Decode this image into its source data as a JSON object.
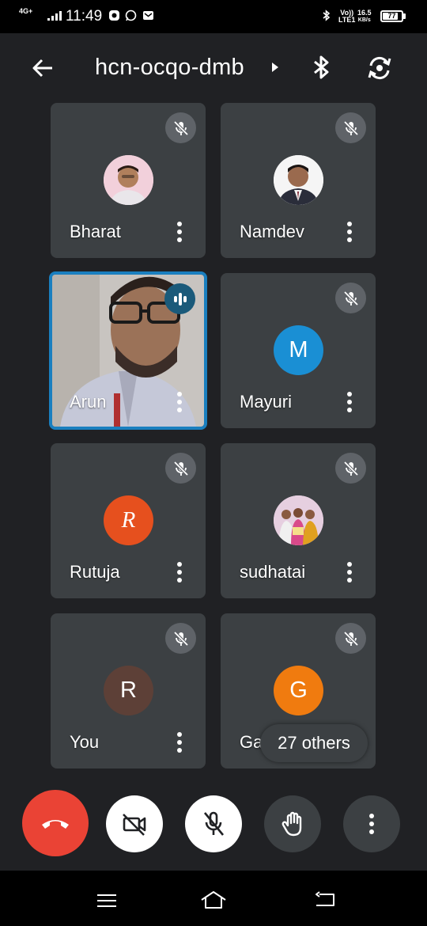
{
  "status_bar": {
    "network_type": "4G+",
    "time": "11:49",
    "volte_label": "Vo))",
    "lte_label": "LTE1",
    "speed_value": "16.5",
    "speed_unit": "KB/s",
    "battery_level": "77"
  },
  "header": {
    "meeting_code": "hcn-ocqo-dmb",
    "back_icon": "arrow-back-icon",
    "audio_icon": "bluetooth-icon",
    "switch_camera_icon": "switch-camera-icon"
  },
  "participants": [
    {
      "name": "Bharat",
      "muted": true,
      "avatar": "photo"
    },
    {
      "name": "Namdev",
      "muted": true,
      "avatar": "photo"
    },
    {
      "name": "Arun",
      "muted": false,
      "speaking": true,
      "video": true
    },
    {
      "name": "Mayuri",
      "muted": true,
      "initial": "M",
      "color": "#1a8fd4"
    },
    {
      "name": "Rutuja",
      "muted": true,
      "initial": "R",
      "color": "#e6501e"
    },
    {
      "name": "sudhatai",
      "muted": true,
      "avatar": "photo"
    },
    {
      "name": "You",
      "muted": true,
      "initial": "R",
      "color": "#5d4037"
    },
    {
      "name": "Gau",
      "muted": true,
      "initial": "G",
      "color": "#f07b0f"
    }
  ],
  "others_label": "27 others",
  "controls": {
    "end_call": "end-call-icon",
    "camera": "camera-off-icon",
    "mic": "mic-off-icon",
    "raise_hand": "hand-icon",
    "more": "more-vert-icon"
  },
  "colors": {
    "end_call": "#ea4335",
    "tile": "#3c4043",
    "active_border": "#1a7fbf"
  }
}
